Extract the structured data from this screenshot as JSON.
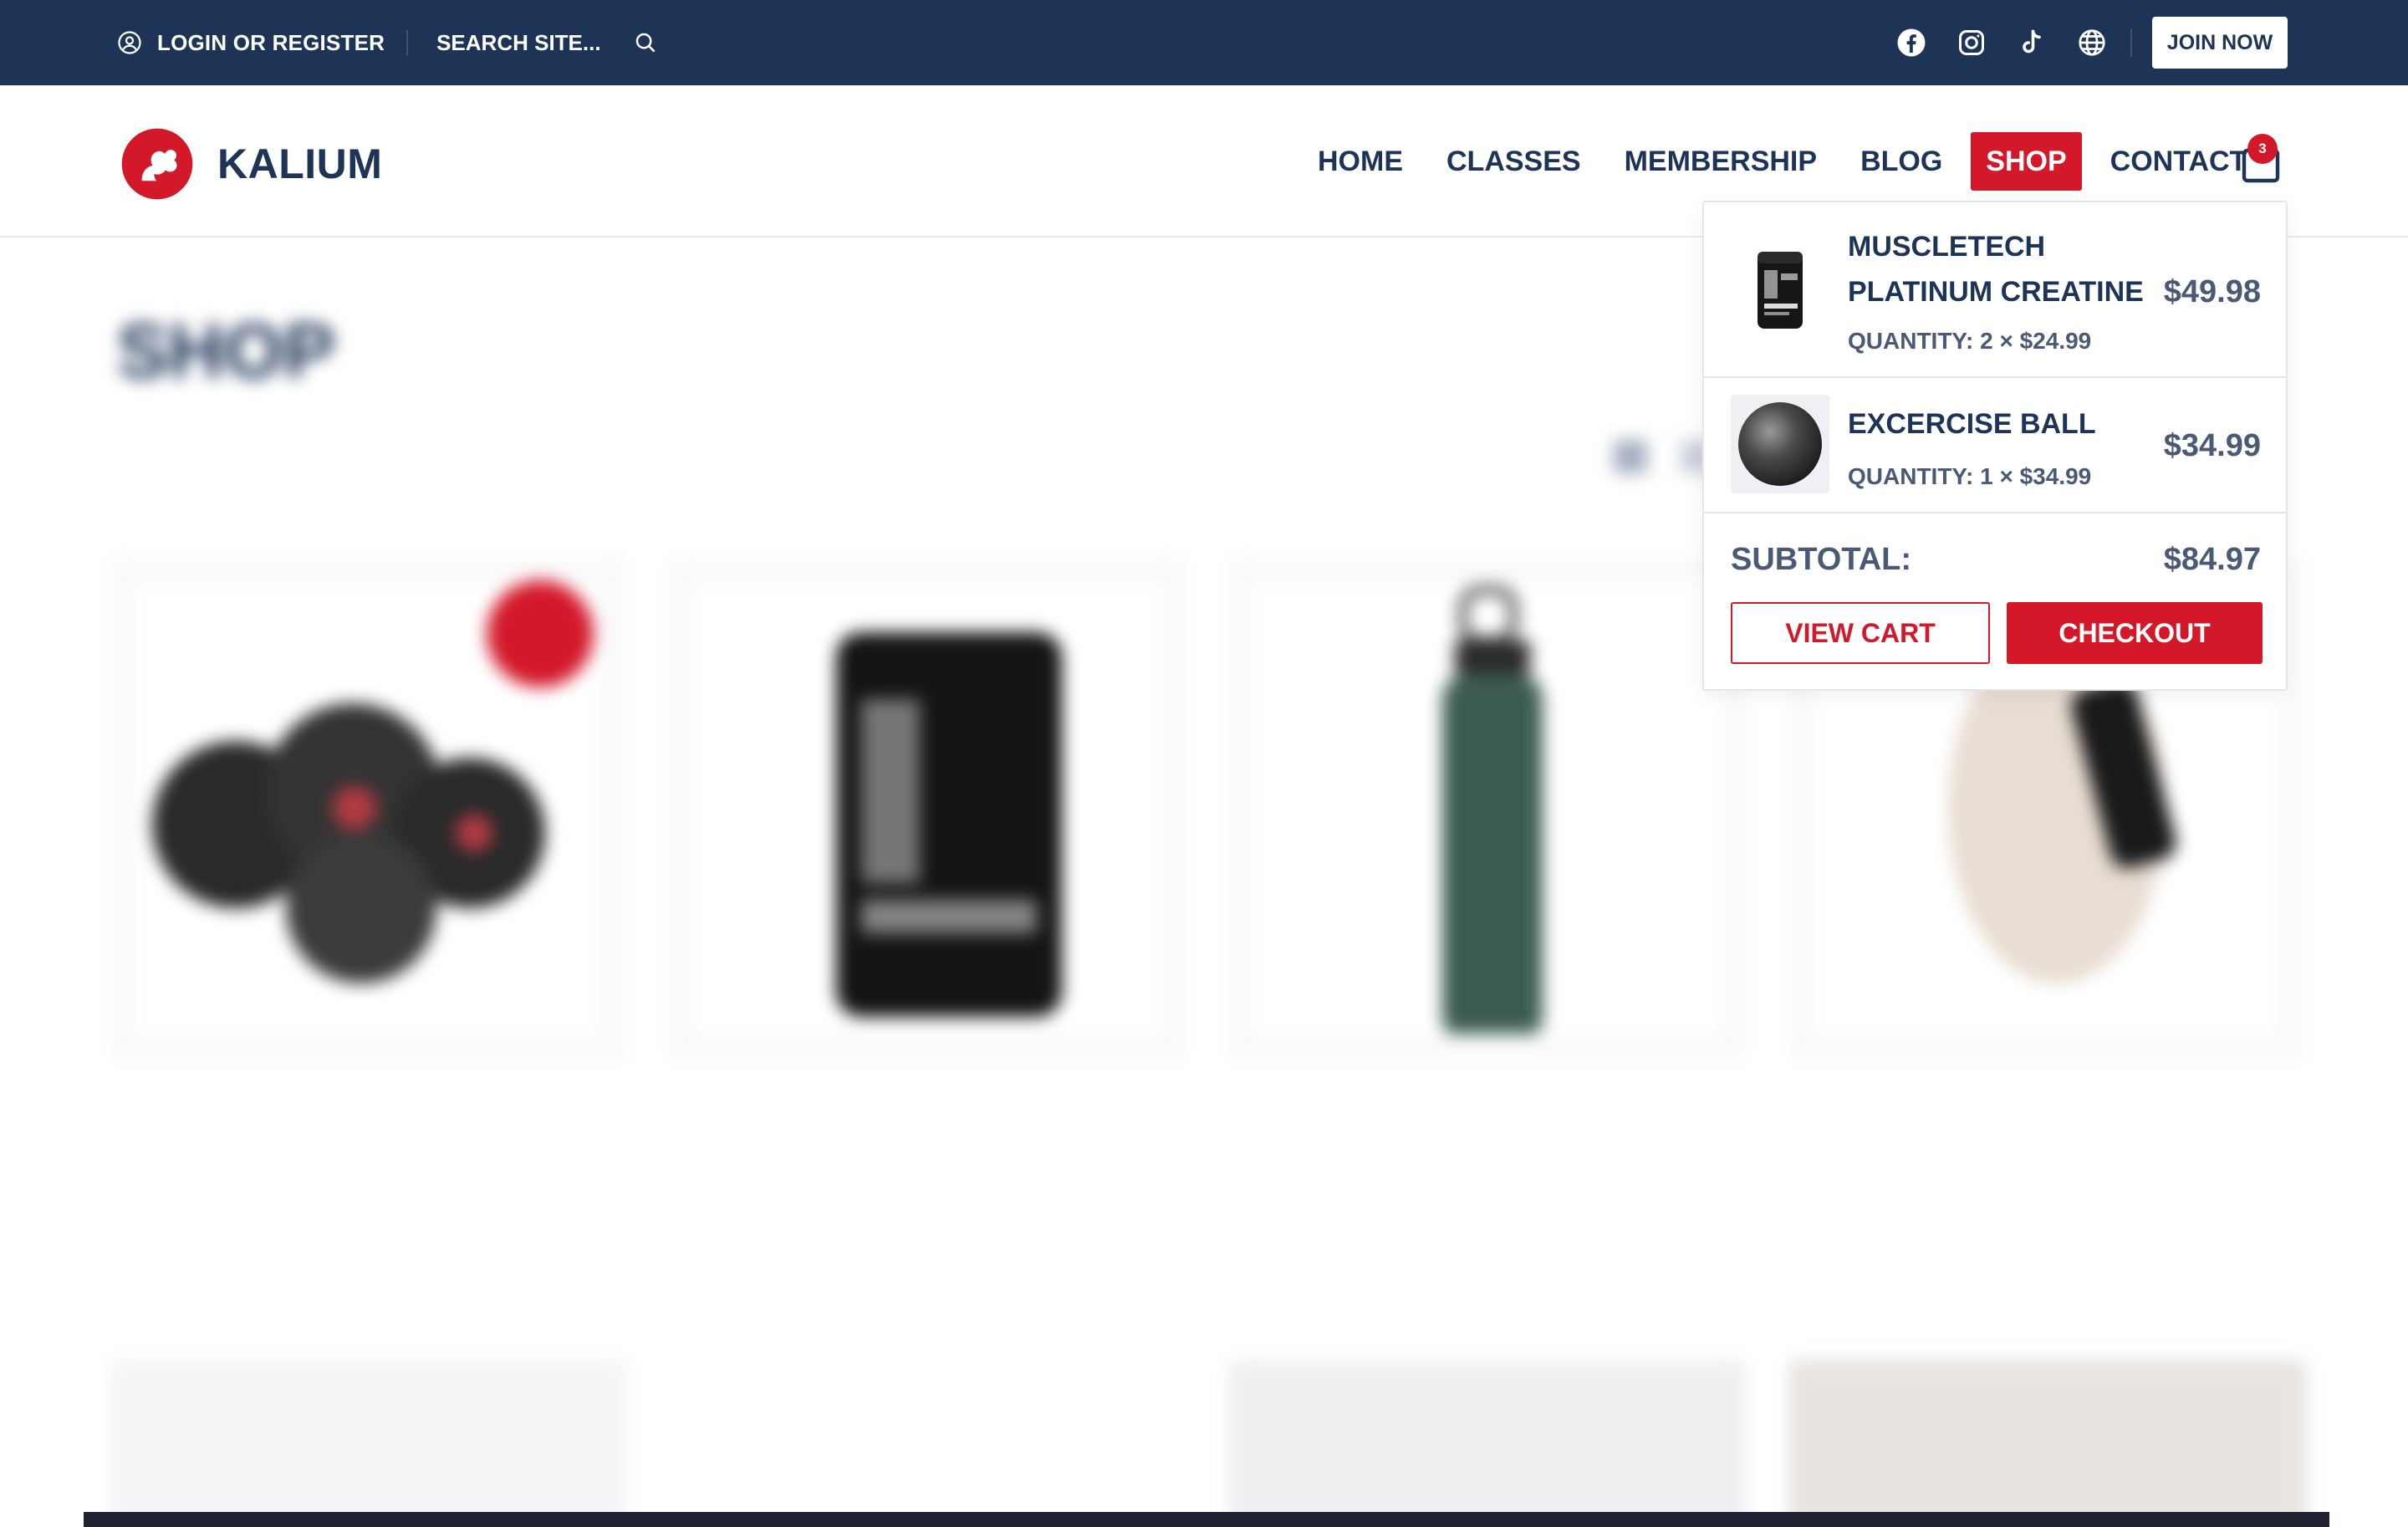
{
  "topbar": {
    "login_label": "LOGIN OR REGISTER",
    "search_placeholder": "SEARCH SITE...",
    "social_icons": [
      "facebook-icon",
      "instagram-icon",
      "tiktok-icon",
      "globe-icon"
    ],
    "join_label": "JOIN NOW"
  },
  "header": {
    "logo_text": "KALIUM",
    "nav": [
      "HOME",
      "CLASSES",
      "MEMBERSHIP",
      "BLOG",
      "SHOP",
      "CONTACT"
    ],
    "active_nav": "SHOP",
    "cart_count": "3"
  },
  "minicart": {
    "items": [
      {
        "name": "MUSCLETECH PLATINUM CREATINE",
        "quantity": "QUANTITY: 2 × $24.99",
        "price": "$49.98"
      },
      {
        "name": "EXCERCISE BALL",
        "quantity": "QUANTITY: 1 × $34.99",
        "price": "$34.99"
      }
    ],
    "subtotal_label": "SUBTOTAL:",
    "subtotal_value": "$84.97",
    "view_cart_label": "VIEW CART",
    "checkout_label": "CHECKOUT"
  },
  "colors": {
    "topbar_bg": "#1e3457",
    "accent_red": "#d3182a",
    "text_navy": "#1e3457"
  }
}
